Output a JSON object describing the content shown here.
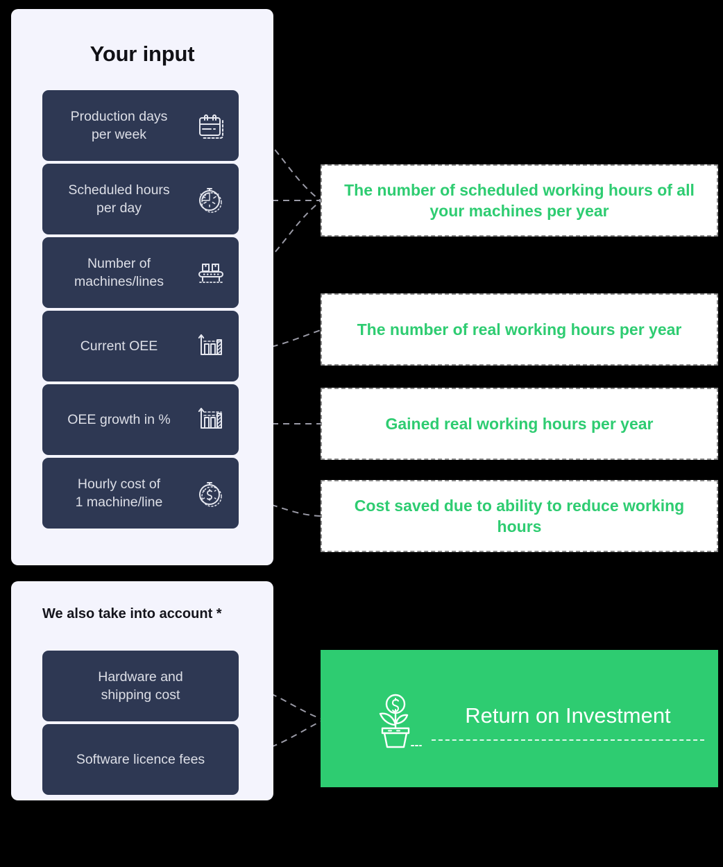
{
  "input_panel": {
    "title": "Your input",
    "cards": [
      {
        "label": "Production days\nper week",
        "icon": "calendar-icon"
      },
      {
        "label": "Scheduled hours\nper day",
        "icon": "stopwatch-icon"
      },
      {
        "label": "Number of\nmachines/lines",
        "icon": "conveyor-belt-icon"
      },
      {
        "label": "Current OEE",
        "icon": "bar-chart-growth-icon"
      },
      {
        "label": "OEE growth in %",
        "icon": "bar-chart-growth-icon"
      },
      {
        "label": "Hourly cost of\n1 machine/line",
        "icon": "stopwatch-dollar-icon"
      }
    ]
  },
  "extra_panel": {
    "title": "We also take into account *",
    "cards": [
      {
        "label": "Hardware and\nshipping cost",
        "icon": "none"
      },
      {
        "label": "Software licence fees",
        "icon": "none"
      }
    ]
  },
  "outcomes": [
    {
      "text": "The number of scheduled working hours of all your machines per year"
    },
    {
      "text": "The number of real working hours per year"
    },
    {
      "text": "Gained real working hours per year"
    },
    {
      "text": "Cost saved due to ability to reduce working hours"
    }
  ],
  "roi": {
    "label": "Return on Investment",
    "icon": "money-plant-icon"
  },
  "colors": {
    "background": "#000000",
    "panel": "#f4f4fd",
    "card": "#2e3853",
    "card_text": "#dddfe7",
    "accent_green": "#2ecc71",
    "outcome_border": "#8c8c8c",
    "connector": "#9a9aa6"
  }
}
